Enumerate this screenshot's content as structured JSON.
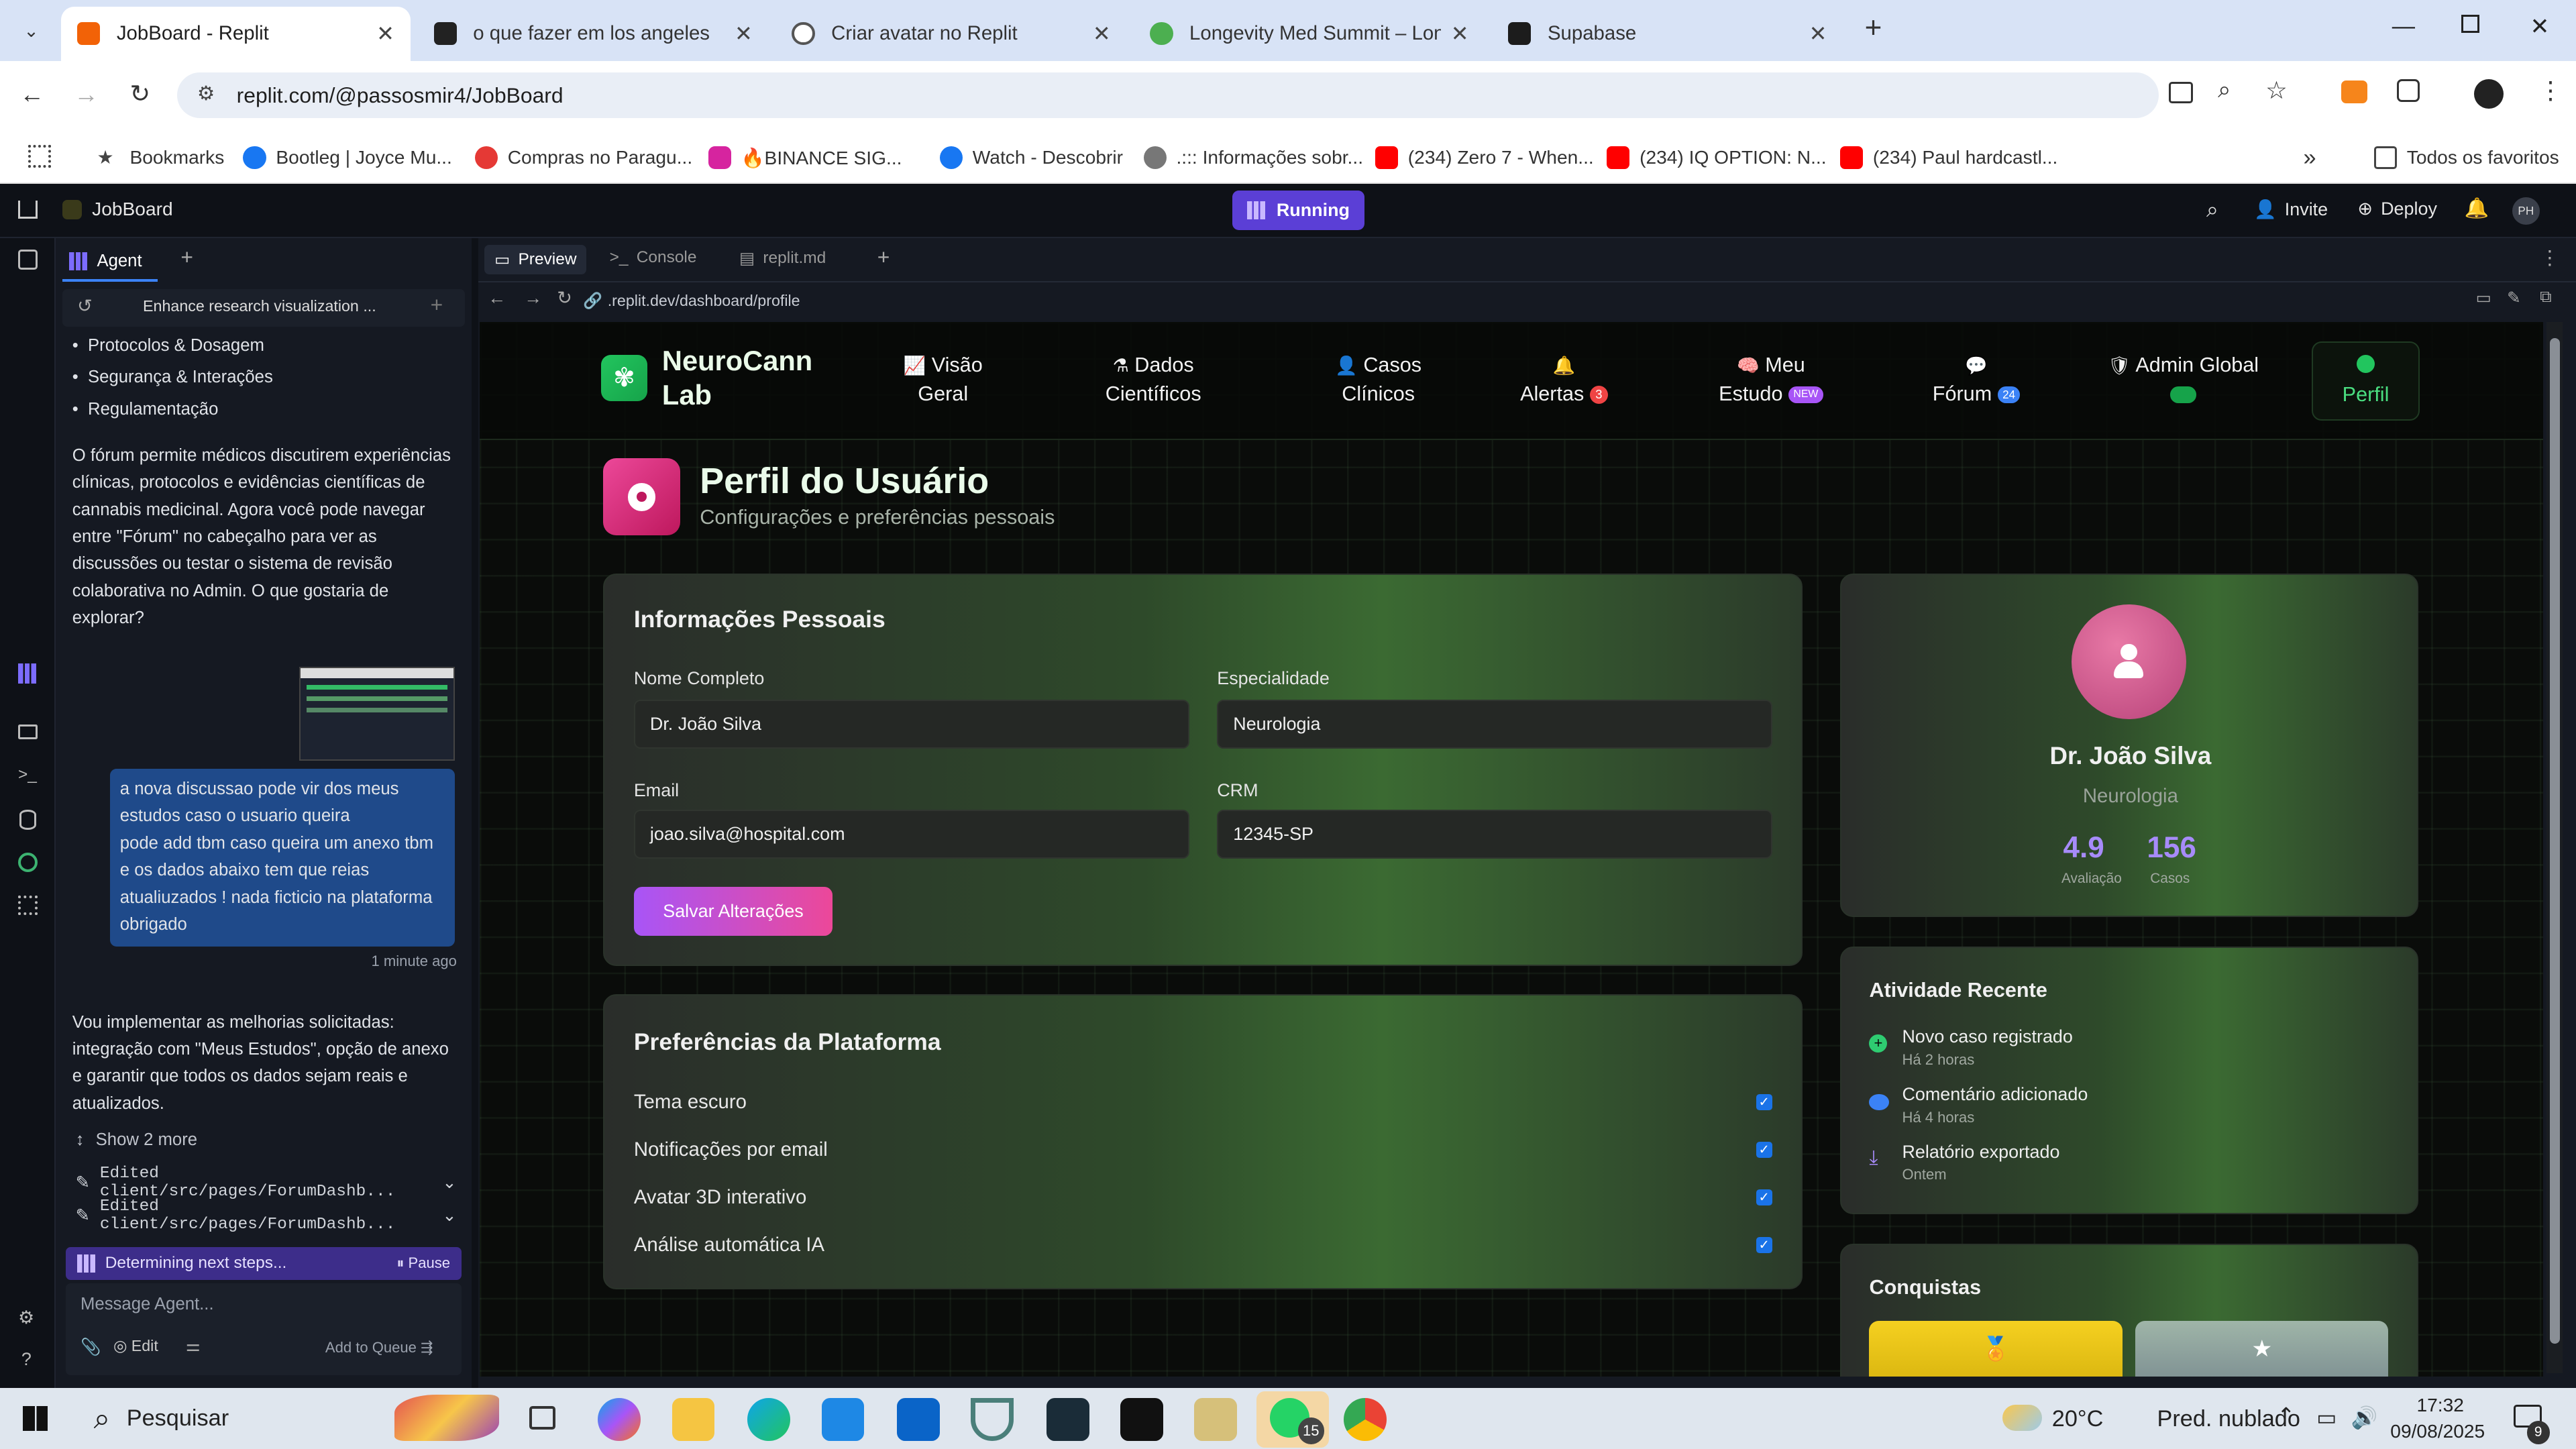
{
  "browser": {
    "tabs": [
      {
        "title": "JobBoard - Replit",
        "color": "#f26207"
      },
      {
        "title": "o que fazer em los angeles",
        "color": "#222222"
      },
      {
        "title": "Criar avatar no Replit",
        "color": "#555555"
      },
      {
        "title": "Longevity Med Summit – Longe",
        "color": "#4caf50"
      },
      {
        "title": "Supabase",
        "color": "#3ecf8e"
      }
    ],
    "url": "replit.com/@passosmir4/JobBoard",
    "bookmarks": [
      "Bookmarks",
      "Bootleg | Joyce Mu...",
      "Compras no Paragu...",
      "🔥BINANCE SIG...",
      "Watch - Descobrir",
      ".::: Informações sobr...",
      "(234) Zero 7 - When...",
      "(234) IQ OPTION: N...",
      "(234) Paul hardcastl..."
    ],
    "bookmarks_more": "»",
    "all_bookmarks": "Todos os favoritos"
  },
  "replit": {
    "project": "JobBoard",
    "status": "Running",
    "invite": "Invite",
    "deploy": "Deploy",
    "avatar": "PH",
    "agent_tab": "Agent",
    "agent_header": "Enhance research visualization ...",
    "agent_bullets": [
      "Protocolos & Dosagem",
      "Segurança & Interações",
      "Regulamentação"
    ],
    "agent_msg1": "O fórum permite médicos discutirem experiências clínicas, protocolos e evidências científicas de cannabis medicinal. Agora você pode navegar entre \"Fórum\" no cabeçalho para ver as discussões ou testar o sistema de revisão colaborativa no Admin. O que gostaria de explorar?",
    "user_msg": "a nova discussao pode vir dos meus estudos caso o usuario queira\npode add tbm caso queira um anexo tbm e os dados abaixo tem que reias atualiuzados ! nada ficticio na plataforma obrigado",
    "user_time": "1 minute ago",
    "agent_msg2": "Vou implementar as melhorias solicitadas: integração com \"Meus Estudos\", opção de anexo e garantir que todos os dados sejam reais e atualizados.",
    "show_more": "Show 2 more",
    "edits": [
      "Edited client/src/pages/ForumDashb...",
      "Edited client/src/pages/ForumDashb..."
    ],
    "progress": "Determining next steps...",
    "pause": "Pause",
    "message_placeholder": "Message Agent...",
    "edit": "Edit",
    "add_queue": "Add to Queue",
    "pane_tabs": [
      "Preview",
      "Console",
      "replit.md"
    ],
    "preview_url": ".replit.dev/dashboard/profile"
  },
  "app": {
    "brand": "NeuroCann Lab",
    "brand_l1": "NeuroCann",
    "brand_l2": "Lab",
    "nav": [
      {
        "l1": "Visão",
        "l2": "Geral",
        "icon": "chart-line-icon"
      },
      {
        "l1": "Dados",
        "l2": "Científicos",
        "icon": "flask-icon"
      },
      {
        "l1": "Casos",
        "l2": "Clínicos",
        "icon": "user-icon"
      },
      {
        "l1": "",
        "l2": "Alertas",
        "badge": "3",
        "icon": "bell-icon"
      },
      {
        "l1": "Meu",
        "l2": "Estudo",
        "badge": "NEW",
        "icon": "brain-icon"
      },
      {
        "l1": "",
        "l2": "Fórum",
        "badge": "24",
        "icon": "comments-icon"
      },
      {
        "l1": "",
        "l2": "Admin Global",
        "icon": "shield-icon"
      },
      {
        "l1": "",
        "l2": "Perfil",
        "icon": "user-circle-icon"
      }
    ],
    "page_title": "Perfil do Usuário",
    "page_subtitle": "Configurações e preferências pessoais",
    "personal": {
      "title": "Informações Pessoais",
      "name_label": "Nome Completo",
      "name": "Dr. João Silva",
      "spec_label": "Especialidade",
      "spec": "Neurologia",
      "email_label": "Email",
      "email": "joao.silva@hospital.com",
      "crm_label": "CRM",
      "crm": "12345-SP",
      "save": "Salvar Alterações"
    },
    "prefs": {
      "title": "Preferências da Plataforma",
      "items": [
        {
          "label": "Tema escuro",
          "checked": true
        },
        {
          "label": "Notificações por email",
          "checked": true
        },
        {
          "label": "Avatar 3D interativo",
          "checked": true
        },
        {
          "label": "Análise automática IA",
          "checked": true
        }
      ]
    },
    "profile": {
      "name": "Dr. João Silva",
      "spec": "Neurologia",
      "rating": "4.9",
      "rating_label": "Avaliação",
      "cases": "156",
      "cases_label": "Casos"
    },
    "activity": {
      "title": "Atividade Recente",
      "items": [
        {
          "text": "Novo caso registrado",
          "time": "Há 2 horas",
          "icon": "plus-circle-icon",
          "color": "#2ecc71"
        },
        {
          "text": "Comentário adicionado",
          "time": "Há 4 horas",
          "icon": "comment-icon",
          "color": "#3b82f6"
        },
        {
          "text": "Relatório exportado",
          "time": "Ontem",
          "icon": "download-icon",
          "color": "#a78bfa"
        }
      ]
    },
    "achievements": {
      "title": "Conquistas"
    }
  },
  "taskbar": {
    "search": "Pesquisar",
    "weather": "20°C",
    "weather_desc": "Pred. nublado",
    "time": "17:32",
    "date": "09/08/2025",
    "whatsapp_badge": "15",
    "notif_badge": "9"
  },
  "colors": {
    "accent": "#7c3aed",
    "green": "#22c55e",
    "pink": "#ec4899"
  }
}
